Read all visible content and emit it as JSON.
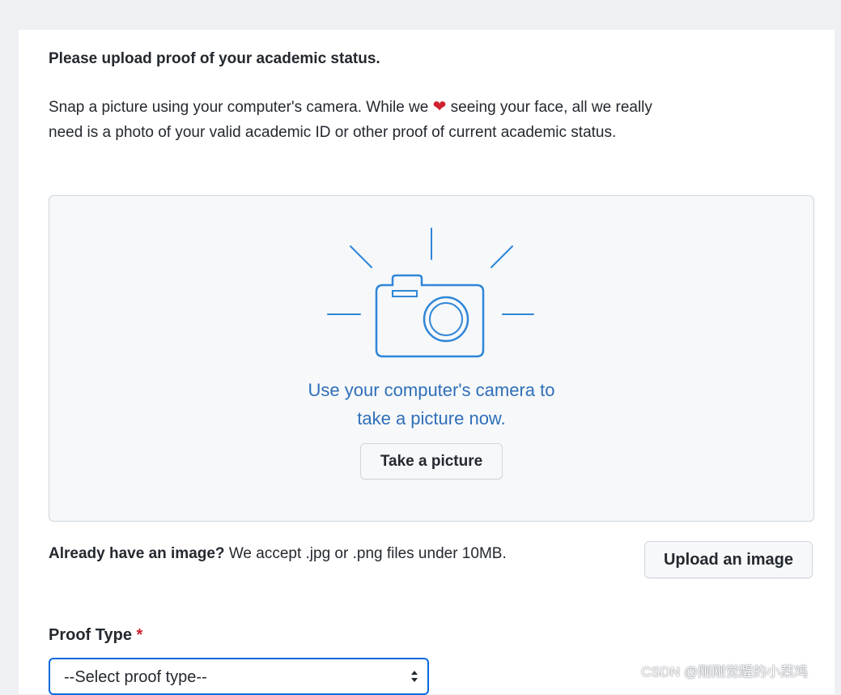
{
  "form": {
    "heading": "Please upload proof of your academic status.",
    "intro_before_heart": "Snap a picture using your computer's camera. While we ",
    "heart_glyph": "❤",
    "intro_after_heart": " seeing your face, all we really need is a photo of your valid academic ID or other proof of current academic status."
  },
  "camera_panel": {
    "line1": "Use your computer's camera to",
    "line2": "take a picture now.",
    "button_label": "Take a picture",
    "icon": "camera-icon",
    "icon_color": "#2f86d8"
  },
  "upload": {
    "bold_text": "Already have an image?",
    "text": " We accept .jpg or .png files under 10MB.",
    "button_label": "Upload an image"
  },
  "proof_type": {
    "label": "Proof Type",
    "required_marker": "*",
    "selected": "--Select proof type--"
  },
  "watermark": "CSDN @刚刚觉醒的小菜鸡",
  "colors": {
    "accent_blue": "#0969da",
    "camera_text": "#2f6fb8",
    "required_red": "#cf222e",
    "panel_bg": "#f6f8fa"
  }
}
